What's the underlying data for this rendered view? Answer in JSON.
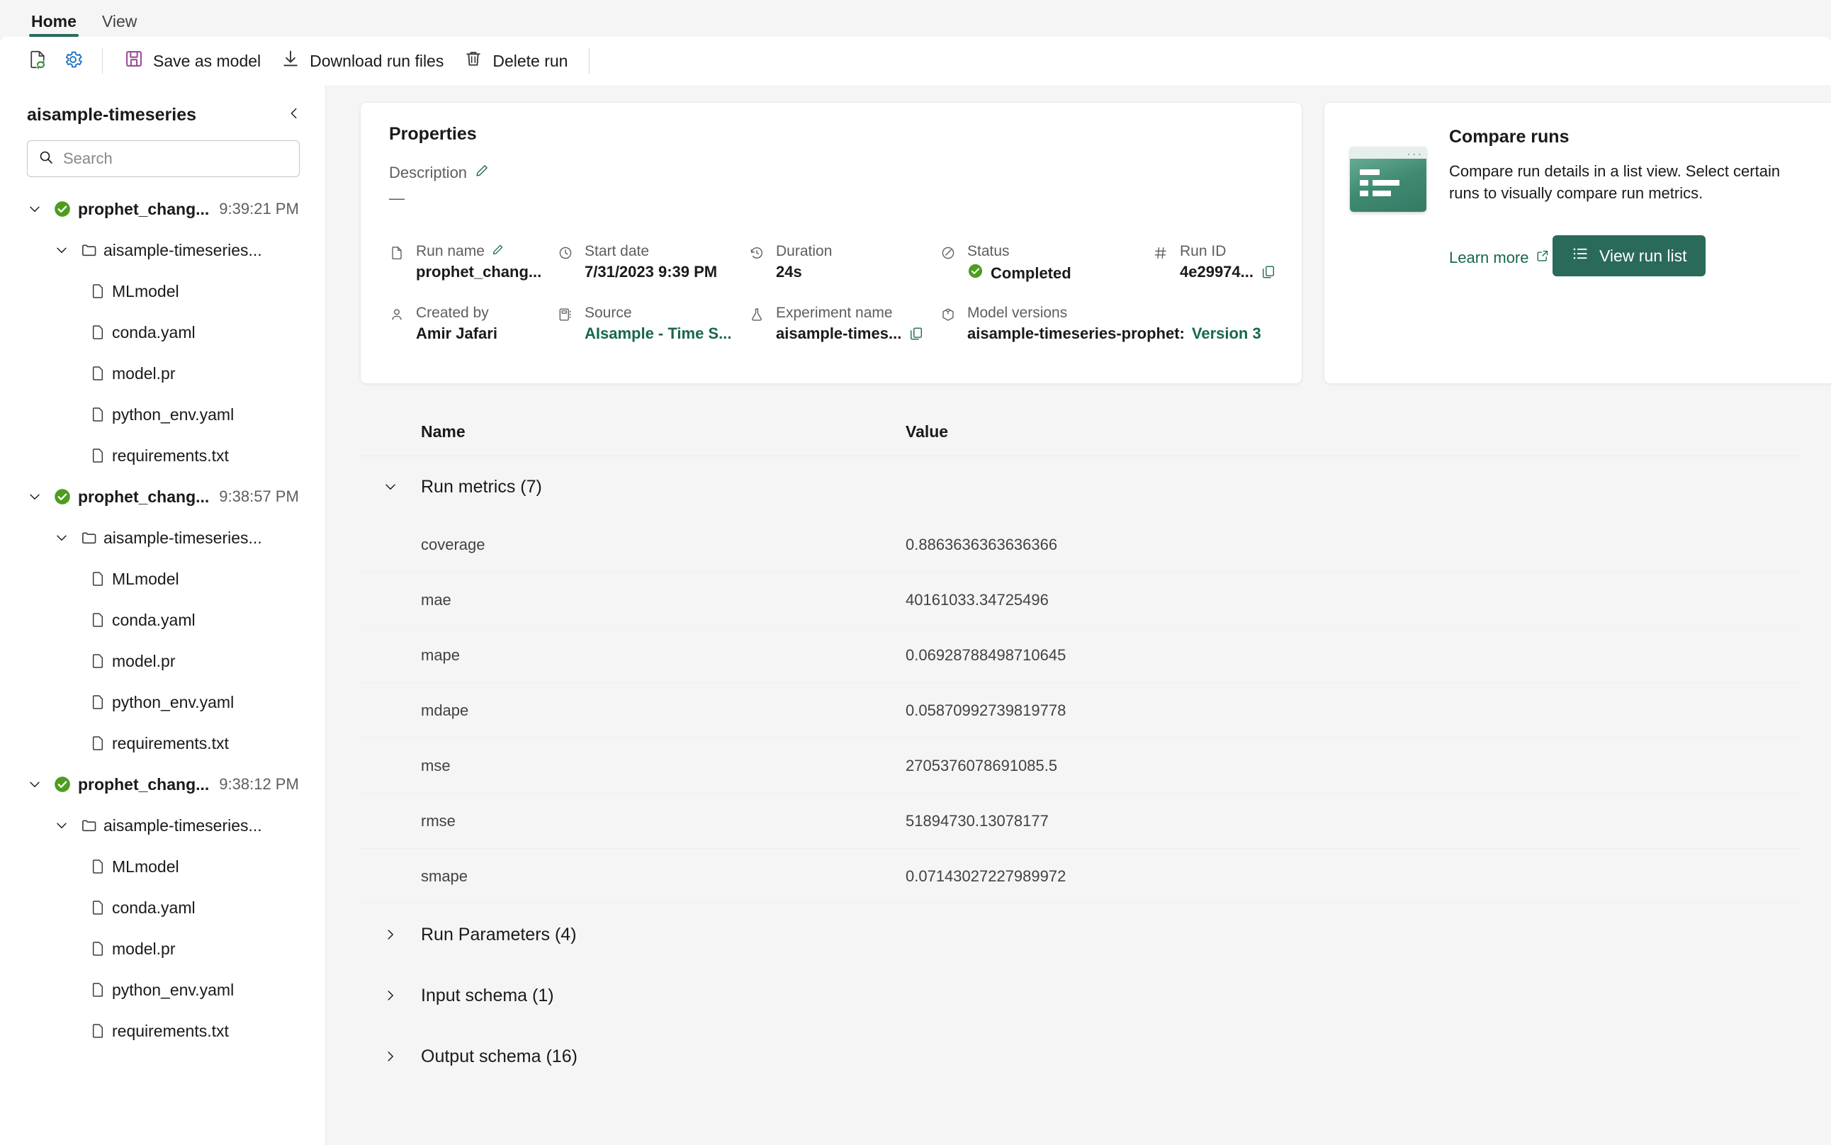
{
  "ribbon": {
    "tabs": [
      {
        "label": "Home",
        "active": true
      },
      {
        "label": "View",
        "active": false
      }
    ]
  },
  "toolbar": {
    "refresh_icon": "refresh-document-icon",
    "settings_icon": "gear-icon",
    "buttons": [
      {
        "label": "Save as model",
        "icon": "save-icon"
      },
      {
        "label": "Download run files",
        "icon": "download-icon"
      },
      {
        "label": "Delete run",
        "icon": "trash-icon"
      }
    ]
  },
  "sidebar": {
    "title": "aisample-timeseries",
    "collapse_icon": "chevron-left-icon",
    "search": {
      "placeholder": "Search",
      "value": "",
      "icon": "search-icon"
    },
    "runs": [
      {
        "name": "prophet_chang...",
        "time": "9:39:21 PM",
        "status_icon": "success-check-icon",
        "expanded": true,
        "folder": "aisample-timeseries...",
        "files": [
          "MLmodel",
          "conda.yaml",
          "model.pr",
          "python_env.yaml",
          "requirements.txt"
        ]
      },
      {
        "name": "prophet_chang...",
        "time": "9:38:57 PM",
        "status_icon": "success-check-icon",
        "expanded": true,
        "folder": "aisample-timeseries...",
        "files": [
          "MLmodel",
          "conda.yaml",
          "model.pr",
          "python_env.yaml",
          "requirements.txt"
        ]
      },
      {
        "name": "prophet_chang...",
        "time": "9:38:12 PM",
        "status_icon": "success-check-icon",
        "expanded": true,
        "folder": "aisample-timeseries...",
        "files": [
          "MLmodel",
          "conda.yaml",
          "model.pr",
          "python_env.yaml",
          "requirements.txt"
        ]
      }
    ]
  },
  "properties": {
    "title": "Properties",
    "description_label": "Description",
    "description_value": "—",
    "edit_icon": "pencil-icon",
    "fields": {
      "run_name": {
        "label": "Run name",
        "value": "prophet_chang...",
        "icon": "document-icon",
        "edit_icon": "pencil-icon"
      },
      "start_date": {
        "label": "Start date",
        "value": "7/31/2023 9:39 PM",
        "icon": "clock-icon"
      },
      "duration": {
        "label": "Duration",
        "value": "24s",
        "icon": "history-icon"
      },
      "status": {
        "label": "Status",
        "value": "Completed",
        "icon": "edit-signature-icon",
        "status_icon": "success-check-icon"
      },
      "run_id": {
        "label": "Run ID",
        "value": "4e29974...",
        "icon": "hash-icon",
        "copy_icon": "copy-icon"
      },
      "created_by": {
        "label": "Created by",
        "value": "Amir Jafari",
        "icon": "person-icon"
      },
      "source": {
        "label": "Source",
        "value": "AIsample - Time S...",
        "icon": "notebook-icon"
      },
      "experiment_name": {
        "label": "Experiment name",
        "value": "aisample-times...",
        "icon": "flask-icon",
        "copy_icon": "copy-icon"
      },
      "model_versions": {
        "label": "Model versions",
        "value": "aisample-timeseries-prophet: ",
        "link": "Version 3",
        "icon": "cube-icon"
      }
    }
  },
  "compare": {
    "title": "Compare runs",
    "description": "Compare run details in a list view. Select certain runs to visually compare run metrics.",
    "learn_more": "Learn more",
    "external_icon": "external-link-icon",
    "button_label": "View run list",
    "button_icon": "list-icon",
    "thumb_icon": "list-view-thumbnail"
  },
  "table": {
    "columns": {
      "name": "Name",
      "value": "Value"
    },
    "groups": [
      {
        "title": "Run metrics (7)",
        "expanded": true,
        "chevron": "chevron-down-icon",
        "rows": [
          {
            "name": "coverage",
            "value": "0.8863636363636366"
          },
          {
            "name": "mae",
            "value": "40161033.34725496"
          },
          {
            "name": "mape",
            "value": "0.06928788498710645"
          },
          {
            "name": "mdape",
            "value": "0.05870992739819778"
          },
          {
            "name": "mse",
            "value": "2705376078691085.5"
          },
          {
            "name": "rmse",
            "value": "51894730.13078177"
          },
          {
            "name": "smape",
            "value": "0.07143027227989972"
          }
        ]
      },
      {
        "title": "Run Parameters (4)",
        "expanded": false,
        "chevron": "chevron-right-icon",
        "rows": []
      },
      {
        "title": "Input schema (1)",
        "expanded": false,
        "chevron": "chevron-right-icon",
        "rows": []
      },
      {
        "title": "Output schema (16)",
        "expanded": false,
        "chevron": "chevron-right-icon",
        "rows": []
      }
    ]
  },
  "colors": {
    "accent": "#2a6a5b",
    "link": "#18674f",
    "success": "#57a300",
    "purple": "#9b4f96",
    "blue": "#0f6cbd"
  }
}
